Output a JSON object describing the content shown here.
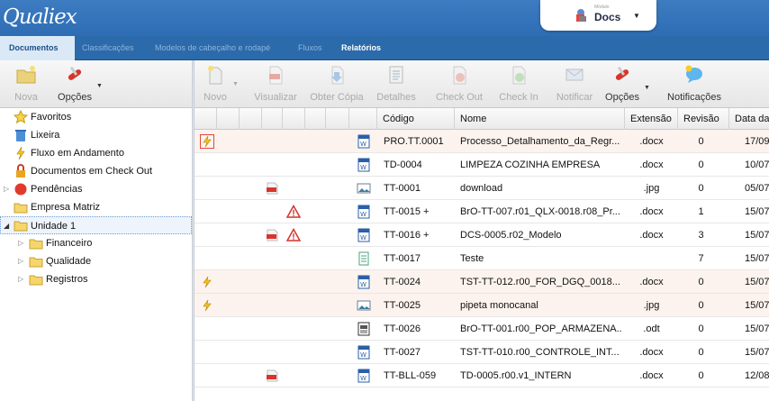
{
  "app": {
    "logo": "Qualiex"
  },
  "module": {
    "small_label": "Módulo",
    "name": "Docs"
  },
  "tabs": [
    "Documentos",
    "Classificações",
    "Modelos de cabeçalho e rodapé",
    "Fluxos",
    "Relatórios"
  ],
  "left_toolbar": {
    "new_label": "Nova",
    "options_label": "Opções"
  },
  "toolbar": {
    "new": "Novo",
    "view": "Visualizar",
    "copy": "Obter Cópia",
    "details": "Detalhes",
    "checkout": "Check Out",
    "checkin": "Check In",
    "notify": "Notificar",
    "options": "Opções",
    "notifications": "Notificações"
  },
  "tree": {
    "items": [
      {
        "label": "Favoritos",
        "icon": "star-icon"
      },
      {
        "label": "Lixeira",
        "icon": "trash-icon"
      },
      {
        "label": "Fluxo em Andamento",
        "icon": "lightning-icon"
      },
      {
        "label": "Documentos em Check Out",
        "icon": "lock-icon"
      },
      {
        "label": "Pendências",
        "icon": "red-circle-icon"
      },
      {
        "label": "Empresa Matriz",
        "icon": "folder-icon"
      },
      {
        "label": "Unidade 1",
        "icon": "folder-open-icon"
      },
      {
        "label": "Financeiro",
        "icon": "folder-icon"
      },
      {
        "label": "Qualidade",
        "icon": "folder-icon"
      },
      {
        "label": "Registros",
        "icon": "folder-icon"
      }
    ]
  },
  "grid": {
    "columns": {
      "code": "Código",
      "name": "Nome",
      "ext": "Extensão",
      "rev": "Revisão",
      "date": "Data da"
    },
    "rows": [
      {
        "code": "PRO.TT.0001",
        "name": "Processo_Detalhamento_da_Regr...",
        "ext": ".docx",
        "rev": "0",
        "date": "17/09",
        "type": "word",
        "flow": true,
        "pdf": false,
        "warn": false
      },
      {
        "code": "TD-0004",
        "name": "LIMPEZA COZINHA EMPRESA",
        "ext": ".docx",
        "rev": "0",
        "date": "10/07",
        "type": "word",
        "flow": false,
        "pdf": false,
        "warn": false
      },
      {
        "code": "TT-0001",
        "name": "download",
        "ext": ".jpg",
        "rev": "0",
        "date": "05/07",
        "type": "image",
        "flow": false,
        "pdf": true,
        "warn": false
      },
      {
        "code": "TT-0015 +",
        "name": "BrO-TT-007.r01_QLX-0018.r08_Pr...",
        "ext": ".docx",
        "rev": "1",
        "date": "15/07",
        "type": "word",
        "flow": false,
        "pdf": false,
        "warn": true
      },
      {
        "code": "TT-0016 +",
        "name": "DCS-0005.r02_Modelo",
        "ext": ".docx",
        "rev": "3",
        "date": "15/07",
        "type": "word",
        "flow": false,
        "pdf": true,
        "warn": true
      },
      {
        "code": "TT-0017",
        "name": "Teste",
        "ext": "",
        "rev": "7",
        "date": "15/07",
        "type": "text",
        "flow": false,
        "pdf": false,
        "warn": false
      },
      {
        "code": "TT-0024",
        "name": "TST-TT-012.r00_FOR_DGQ_0018...",
        "ext": ".docx",
        "rev": "0",
        "date": "15/07",
        "type": "word",
        "flow": true,
        "pdf": false,
        "warn": false
      },
      {
        "code": "TT-0025",
        "name": "pipeta monocanal",
        "ext": ".jpg",
        "rev": "0",
        "date": "15/07",
        "type": "image",
        "flow": true,
        "pdf": false,
        "warn": false
      },
      {
        "code": "TT-0026",
        "name": "BrO-TT-001.r00_POP_ARMAZENA...",
        "ext": ".odt",
        "rev": "0",
        "date": "15/07",
        "type": "odt",
        "flow": false,
        "pdf": false,
        "warn": false
      },
      {
        "code": "TT-0027",
        "name": "TST-TT-010.r00_CONTROLE_INT...",
        "ext": ".docx",
        "rev": "0",
        "date": "15/07",
        "type": "word",
        "flow": false,
        "pdf": false,
        "warn": false
      },
      {
        "code": "TT-BLL-059",
        "name": "TD-0005.r00.v1_INTERN",
        "ext": ".docx",
        "rev": "0",
        "date": "12/08",
        "type": "word",
        "flow": false,
        "pdf": true,
        "warn": false
      }
    ]
  }
}
